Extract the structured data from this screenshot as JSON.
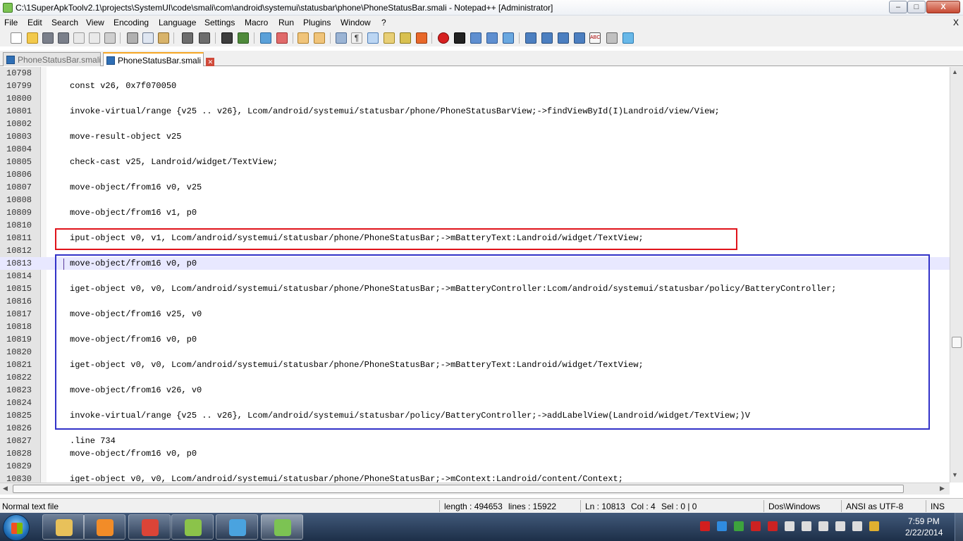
{
  "window": {
    "title": "C:\\1SuperApkToolv2.1\\projects\\SystemUI\\code\\smali\\com\\android\\systemui\\statusbar\\phone\\PhoneStatusBar.smali - Notepad++ [Administrator]",
    "min_icon": "minimize-icon",
    "max_icon": "maximize-icon",
    "close_label": "X"
  },
  "menu": {
    "items": [
      "File",
      "Edit",
      "Search",
      "View",
      "Encoding",
      "Language",
      "Settings",
      "Macro",
      "Run",
      "Plugins",
      "Window",
      "?"
    ],
    "close": "X"
  },
  "toolbar": {
    "icons": [
      "new-file-icon",
      "open-file-icon",
      "save-icon",
      "save-all-icon",
      "close-icon",
      "close-all-icon",
      "print-icon",
      "cut-icon",
      "copy-icon",
      "paste-icon",
      "undo-icon",
      "redo-icon",
      "find-icon",
      "replace-icon",
      "zoom-in-icon",
      "zoom-out-icon",
      "sync-vertical-icon",
      "sync-horizontal-icon",
      "word-wrap-icon",
      "show-all-chars-icon",
      "indent-guide-icon",
      "user-language-icon",
      "doc-map-icon",
      "function-list-icon",
      "record-macro-icon",
      "stop-record-icon",
      "play-macro-icon",
      "run-macro-multiple-icon",
      "save-macro-icon",
      "prev-bookmark-icon",
      "next-bookmark-icon",
      "bookmark-icon",
      "spellcheck-icon",
      "spellcheck-options-icon",
      "spellcheck-extra-icon"
    ]
  },
  "tabs": [
    {
      "label": "PhoneStatusBar.smali",
      "active": false
    },
    {
      "label": "PhoneStatusBar.smali",
      "active": true
    }
  ],
  "editor": {
    "lines": [
      {
        "n": "10798",
        "code": ""
      },
      {
        "n": "10799",
        "code": "const v26, 0x7f070050"
      },
      {
        "n": "10800",
        "code": ""
      },
      {
        "n": "10801",
        "code": "invoke-virtual/range {v25 .. v26}, Lcom/android/systemui/statusbar/phone/PhoneStatusBarView;->findViewById(I)Landroid/view/View;"
      },
      {
        "n": "10802",
        "code": ""
      },
      {
        "n": "10803",
        "code": "move-result-object v25"
      },
      {
        "n": "10804",
        "code": ""
      },
      {
        "n": "10805",
        "code": "check-cast v25, Landroid/widget/TextView;"
      },
      {
        "n": "10806",
        "code": ""
      },
      {
        "n": "10807",
        "code": "move-object/from16 v0, v25"
      },
      {
        "n": "10808",
        "code": ""
      },
      {
        "n": "10809",
        "code": "move-object/from16 v1, p0"
      },
      {
        "n": "10810",
        "code": ""
      },
      {
        "n": "10811",
        "code": "iput-object v0, v1, Lcom/android/systemui/statusbar/phone/PhoneStatusBar;->mBatteryText:Landroid/widget/TextView;"
      },
      {
        "n": "10812",
        "code": ""
      },
      {
        "n": "10813",
        "code": "move-object/from16 v0, p0"
      },
      {
        "n": "10814",
        "code": ""
      },
      {
        "n": "10815",
        "code": "iget-object v0, v0, Lcom/android/systemui/statusbar/phone/PhoneStatusBar;->mBatteryController:Lcom/android/systemui/statusbar/policy/BatteryController;"
      },
      {
        "n": "10816",
        "code": ""
      },
      {
        "n": "10817",
        "code": "move-object/from16 v25, v0"
      },
      {
        "n": "10818",
        "code": ""
      },
      {
        "n": "10819",
        "code": "move-object/from16 v0, p0"
      },
      {
        "n": "10820",
        "code": ""
      },
      {
        "n": "10821",
        "code": "iget-object v0, v0, Lcom/android/systemui/statusbar/phone/PhoneStatusBar;->mBatteryText:Landroid/widget/TextView;"
      },
      {
        "n": "10822",
        "code": ""
      },
      {
        "n": "10823",
        "code": "move-object/from16 v26, v0"
      },
      {
        "n": "10824",
        "code": ""
      },
      {
        "n": "10825",
        "code": "invoke-virtual/range {v25 .. v26}, Lcom/android/systemui/statusbar/policy/BatteryController;->addLabelView(Landroid/widget/TextView;)V"
      },
      {
        "n": "10826",
        "code": ""
      },
      {
        "n": "10827",
        "code": ".line 734"
      },
      {
        "n": "10828",
        "code": "move-object/from16 v0, p0"
      },
      {
        "n": "10829",
        "code": ""
      },
      {
        "n": "10830",
        "code": "iget-object v0, v0, Lcom/android/systemui/statusbar/phone/PhoneStatusBar;->mContext:Landroid/content/Context;"
      }
    ],
    "current_line": "10813"
  },
  "status": {
    "file_type": "Normal text file",
    "length": "length : 494653",
    "lines": "lines : 15922",
    "ln": "Ln : 10813",
    "col": "Col : 4",
    "sel": "Sel : 0 | 0",
    "eol": "Dos\\Windows",
    "encoding": "ANSI as UTF-8",
    "mode": "INS"
  },
  "taskbar": {
    "apps": [
      {
        "name": "file-explorer-icon",
        "color": "#e8c15a"
      },
      {
        "name": "media-player-icon",
        "color": "#f28c28"
      },
      {
        "name": "chrome-icon",
        "color": "#db4437"
      },
      {
        "name": "apk-tool-icon",
        "color": "#8bc34a"
      },
      {
        "name": "paint-icon",
        "color": "#4aa3df"
      },
      {
        "name": "notepadpp-icon",
        "color": "#7cc353"
      }
    ],
    "tray_icons": [
      "antivirus-icon",
      "dropbox-icon",
      "network-share-icon",
      "flag-icon",
      "security-icon",
      "usb-icon",
      "signal-icon",
      "bluetooth-icon",
      "volume-icon",
      "monitor-icon",
      "wand-icon"
    ],
    "time": "7:59 PM",
    "date": "2/22/2014"
  }
}
